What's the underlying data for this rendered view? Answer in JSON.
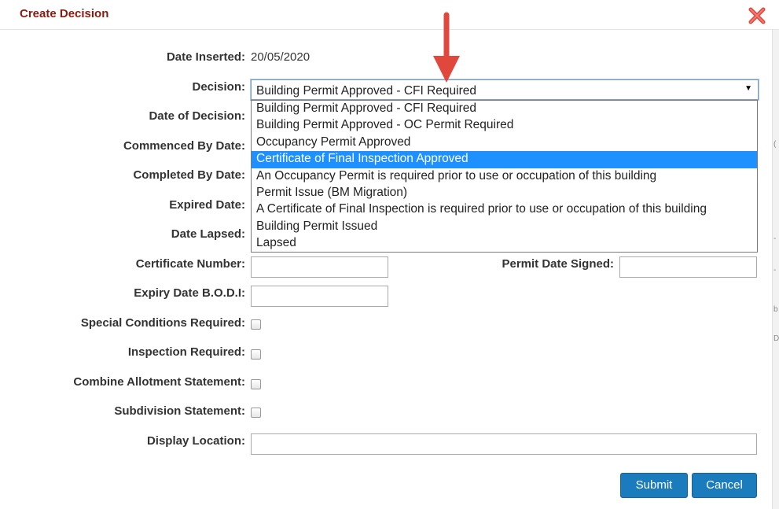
{
  "dialog": {
    "title": "Create Decision"
  },
  "fields": {
    "date_inserted_label": "Date Inserted:",
    "date_inserted_value": "20/05/2020",
    "decision_label": "Decision:",
    "decision_selected": "Building Permit Approved - CFI Required",
    "decision_options": [
      "Building Permit Approved - CFI Required",
      "Building Permit Approved - OC Permit Required",
      "Occupancy Permit Approved",
      "Certificate of Final Inspection Approved",
      "An Occupancy Permit is required prior to use or occupation of this building",
      "Permit Issue (BM Migration)",
      "A Certificate of Final Inspection is required prior to use or occupation of this building",
      "Building Permit Issued",
      "Lapsed"
    ],
    "highlighted_option_index": 3,
    "date_of_decision_label": "Date of Decision:",
    "commenced_by_label": "Commenced By Date:",
    "completed_by_label": "Completed By Date:",
    "expired_date_label": "Expired Date:",
    "date_lapsed_label": "Date Lapsed:",
    "certificate_number_label": "Certificate Number:",
    "certificate_number_value": "",
    "permit_date_signed_label": "Permit Date Signed:",
    "permit_date_signed_value": "",
    "expiry_bodi_label": "Expiry Date B.O.D.I:",
    "expiry_bodi_value": "",
    "special_conditions_label": "Special Conditions Required:",
    "special_conditions_checked": false,
    "inspection_required_label": "Inspection Required:",
    "inspection_required_checked": false,
    "combine_allotment_label": "Combine Allotment Statement:",
    "combine_allotment_checked": false,
    "subdivision_label": "Subdivision Statement:",
    "subdivision_checked": false,
    "display_location_label": "Display Location:",
    "display_location_value": ""
  },
  "buttons": {
    "submit": "Submit",
    "cancel": "Cancel"
  },
  "icons": {
    "close": "close-icon",
    "dropdown": "caret-down-icon",
    "annotation": "red-arrow-down-icon"
  },
  "colors": {
    "title": "#8b1a10",
    "button_bg": "#1a7bbd",
    "highlight": "#1e90ff",
    "annotation_arrow": "#e0473d",
    "close_x": "#e0473d"
  }
}
